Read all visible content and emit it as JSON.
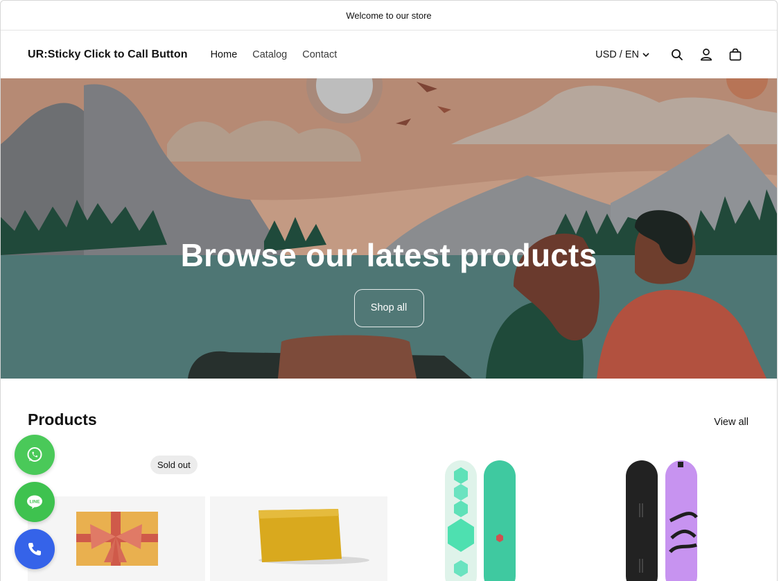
{
  "announcement": {
    "text": "Welcome to our store"
  },
  "header": {
    "brand": "UR:Sticky Click to Call Button",
    "nav": [
      {
        "label": "Home"
      },
      {
        "label": "Catalog"
      },
      {
        "label": "Contact"
      }
    ],
    "locale": "USD / EN",
    "icons": [
      "search-icon",
      "account-icon",
      "cart-icon"
    ]
  },
  "hero": {
    "title": "Browse our latest products",
    "button": "Shop all"
  },
  "products": {
    "title": "Products",
    "view_all": "View all",
    "badges": {
      "sold_out": "Sold out"
    }
  },
  "floating_buttons": [
    {
      "name": "whatsapp",
      "color": "#4ac959"
    },
    {
      "name": "line",
      "color": "#3ec24f",
      "label": "LINE"
    },
    {
      "name": "phone",
      "color": "#3563e9"
    }
  ],
  "colors": {
    "hero_sky": "#c8a88f",
    "hero_water": "#4d7a78",
    "hero_overlay_text": "#ffffff"
  }
}
